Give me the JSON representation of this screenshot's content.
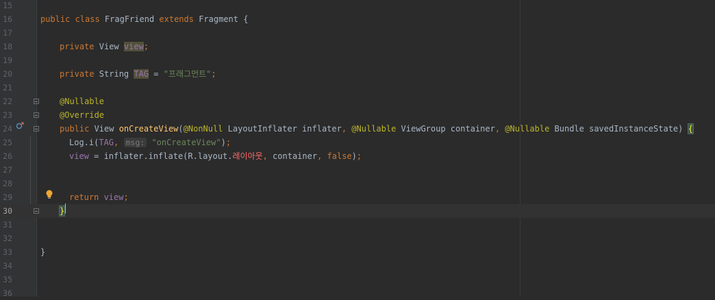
{
  "editor": {
    "lines": [
      {
        "num": "15"
      },
      {
        "num": "16",
        "t": [
          [
            "kw",
            "public class "
          ],
          [
            "p",
            "FragFriend "
          ],
          [
            "kw",
            "extends "
          ],
          [
            "p",
            "Fragment {"
          ]
        ]
      },
      {
        "num": "17"
      },
      {
        "num": "18",
        "t": [
          [
            "kw",
            "private "
          ],
          [
            "p",
            "View "
          ],
          [
            "fld-ref",
            "view"
          ],
          [
            "kw",
            ";"
          ]
        ]
      },
      {
        "num": "19"
      },
      {
        "num": "20",
        "t": [
          [
            "kw",
            "private "
          ],
          [
            "p",
            "String "
          ],
          [
            "fld-ref",
            "TAG"
          ],
          [
            "p",
            " = "
          ],
          [
            "str",
            "\"프래그먼트\""
          ],
          [
            "kw",
            ";"
          ]
        ]
      },
      {
        "num": "21"
      },
      {
        "num": "22",
        "t": [
          [
            "ann",
            "@Nullable"
          ]
        ]
      },
      {
        "num": "23",
        "t": [
          [
            "ann",
            "@Override"
          ]
        ]
      },
      {
        "num": "24",
        "t": [
          [
            "kw",
            "public "
          ],
          [
            "p",
            "View "
          ],
          [
            "fn",
            "onCreateView"
          ],
          [
            "p",
            "("
          ],
          [
            "ann",
            "@NonNull "
          ],
          [
            "p",
            "LayoutInflater inflater"
          ],
          [
            "kw",
            ", "
          ],
          [
            "ann",
            "@Nullable "
          ],
          [
            "p",
            "ViewGroup container"
          ],
          [
            "kw",
            ", "
          ],
          [
            "ann",
            "@Nullable "
          ],
          [
            "p",
            "Bundle savedInstanceState) "
          ],
          [
            "brace",
            "{"
          ]
        ]
      },
      {
        "num": "25",
        "t": [
          [
            "p",
            "Log."
          ],
          [
            "p",
            "i("
          ],
          [
            "fld",
            "TAG"
          ],
          [
            "kw",
            ", "
          ],
          [
            "hint",
            "msg:"
          ],
          [
            "p",
            " "
          ],
          [
            "str",
            "\"onCreateView\""
          ],
          [
            "p",
            ")"
          ],
          [
            "kw",
            ";"
          ]
        ]
      },
      {
        "num": "26",
        "t": [
          [
            "fld",
            "view"
          ],
          [
            "p",
            " = inflater.inflate(R.layout."
          ],
          [
            "err",
            "레이아웃"
          ],
          [
            "kw",
            ", "
          ],
          [
            "p",
            "container"
          ],
          [
            "kw",
            ", "
          ],
          [
            "kw",
            "false"
          ],
          [
            "p",
            ")"
          ],
          [
            "kw",
            ";"
          ]
        ]
      },
      {
        "num": "27"
      },
      {
        "num": "28"
      },
      {
        "num": "29",
        "t": [
          [
            "kw",
            "return "
          ],
          [
            "fld",
            "view"
          ],
          [
            "kw",
            ";"
          ]
        ]
      },
      {
        "num": "30",
        "t": [
          [
            "brace",
            "}"
          ]
        ]
      },
      {
        "num": "31"
      },
      {
        "num": "32"
      },
      {
        "num": "33",
        "t": [
          [
            "p",
            "}"
          ]
        ]
      },
      {
        "num": "34"
      },
      {
        "num": "35"
      },
      {
        "num": "36"
      }
    ],
    "current_line": "30",
    "icons": {
      "override": "override-method-icon",
      "intention": "lightbulb-icon",
      "fold": "fold-marker-icon"
    }
  }
}
